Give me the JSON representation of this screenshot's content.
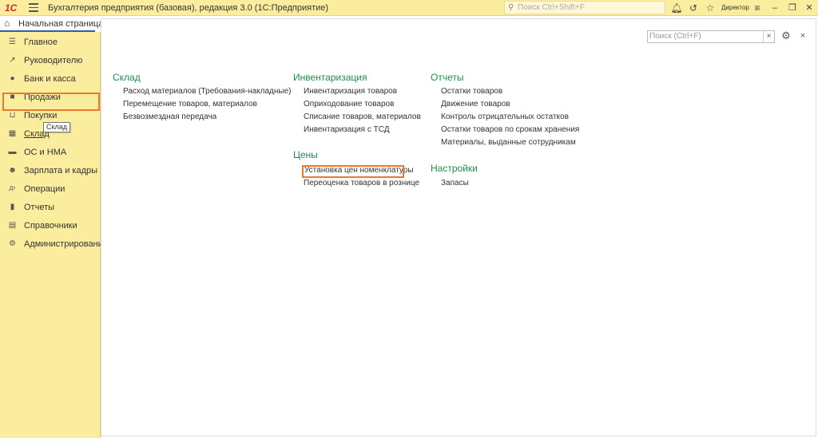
{
  "titlebar": {
    "logo": "1С",
    "title": "Бухгалтерия предприятия (базовая), редакция 3.0  (1С:Предприятие)",
    "search_placeholder": "Поиск Ctrl+Shift+F",
    "user": "Директор"
  },
  "home_tab": {
    "label": "Начальная страница"
  },
  "sidebar": {
    "items": [
      {
        "label": "Главное",
        "icon": "menu-icon"
      },
      {
        "label": "Руководителю",
        "icon": "trend-icon"
      },
      {
        "label": "Банк и касса",
        "icon": "coin-icon"
      },
      {
        "label": "Продажи",
        "icon": "bag-icon"
      },
      {
        "label": "Покупки",
        "icon": "cart-icon"
      },
      {
        "label": "Склад",
        "icon": "grid-icon"
      },
      {
        "label": "ОС и НМА",
        "icon": "truck-icon"
      },
      {
        "label": "Зарплата и кадры",
        "icon": "person-icon"
      },
      {
        "label": "Операции",
        "icon": "dt-kt-icon"
      },
      {
        "label": "Отчеты",
        "icon": "bar-chart-icon"
      },
      {
        "label": "Справочники",
        "icon": "book-icon"
      },
      {
        "label": "Администрирование",
        "icon": "gear-icon"
      }
    ],
    "tooltip": "Склад"
  },
  "content": {
    "search_placeholder": "Поиск (Ctrl+F)",
    "sections": {
      "sklad": {
        "title": "Склад",
        "links": [
          "Расход материалов (Требования-накладные)",
          "Перемещение товаров, материалов",
          "Безвозмездная передача"
        ]
      },
      "inventarizacia": {
        "title": "Инвентаризация",
        "links": [
          "Инвентаризация товаров",
          "Оприходование товаров",
          "Списание товаров, материалов",
          "Инвентаризация с ТСД"
        ]
      },
      "ceny": {
        "title": "Цены",
        "links": [
          "Установка цен номенклатуры",
          "Переоценка товаров в рознице"
        ]
      },
      "otchety": {
        "title": "Отчеты",
        "links": [
          "Остатки товаров",
          "Движение товаров",
          "Контроль отрицательных остатков",
          "Остатки товаров по срокам хранения",
          "Материалы, выданные сотрудникам"
        ]
      },
      "nastroiki": {
        "title": "Настройки",
        "links": [
          "Запасы"
        ]
      }
    }
  },
  "colors": {
    "accent": "#1d8f4c",
    "highlight": "#e97b2c",
    "panel": "#fbed9e"
  }
}
